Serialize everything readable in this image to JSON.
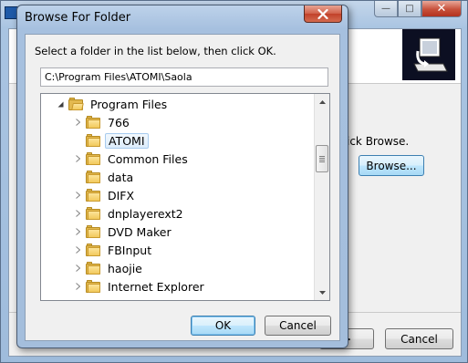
{
  "background_window": {
    "title": "",
    "instruction_fragment": "ick Browse.",
    "browse_label": "Browse...",
    "next_label": ">",
    "cancel_label": "Cancel"
  },
  "dialog": {
    "title": "Browse For Folder",
    "instruction": "Select a folder in the list below, then click OK.",
    "path_value": "C:\\Program Files\\ATOMI\\Saola",
    "tree": [
      {
        "label": "Program Files",
        "level": 0,
        "expander": "expanded",
        "icon": "folder-open-icon",
        "selected": false
      },
      {
        "label": "766",
        "level": 1,
        "expander": "collapsed",
        "icon": "folder-icon",
        "selected": false
      },
      {
        "label": "ATOMI",
        "level": 1,
        "expander": "none",
        "icon": "folder-icon",
        "selected": true
      },
      {
        "label": "Common Files",
        "level": 1,
        "expander": "collapsed",
        "icon": "folder-icon",
        "selected": false
      },
      {
        "label": "data",
        "level": 1,
        "expander": "none",
        "icon": "folder-icon",
        "selected": false
      },
      {
        "label": "DIFX",
        "level": 1,
        "expander": "collapsed",
        "icon": "folder-icon",
        "selected": false
      },
      {
        "label": "dnplayerext2",
        "level": 1,
        "expander": "collapsed",
        "icon": "folder-icon",
        "selected": false
      },
      {
        "label": "DVD Maker",
        "level": 1,
        "expander": "collapsed",
        "icon": "folder-icon",
        "selected": false
      },
      {
        "label": "FBInput",
        "level": 1,
        "expander": "collapsed",
        "icon": "folder-icon",
        "selected": false
      },
      {
        "label": "haojie",
        "level": 1,
        "expander": "collapsed",
        "icon": "folder-icon",
        "selected": false
      },
      {
        "label": "Internet Explorer",
        "level": 1,
        "expander": "collapsed",
        "icon": "folder-icon",
        "selected": false
      }
    ],
    "ok_label": "OK",
    "cancel_label": "Cancel"
  },
  "icons": {
    "close": "close-icon",
    "minimize": "minimize-icon",
    "maximize": "maximize-icon",
    "expander_collapsed": "chevron-right-icon",
    "expander_expanded": "triangle-down-icon",
    "scroll_up": "scroll-up-icon",
    "scroll_down": "scroll-down-icon"
  },
  "colors": {
    "selection_fill": "#dcecfb",
    "folder": "#f2c95c",
    "default_button_border": "#3c7fb1"
  }
}
